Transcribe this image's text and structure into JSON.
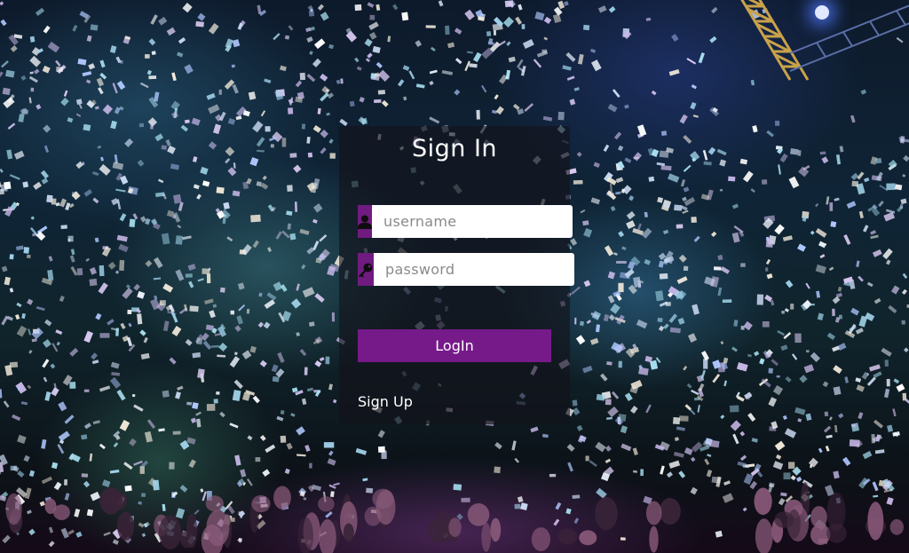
{
  "signin": {
    "title": "Sign In",
    "username": {
      "value": "",
      "placeholder": "username",
      "icon": "user-icon"
    },
    "password": {
      "value": "",
      "placeholder": "password",
      "icon": "key-icon"
    },
    "login_label": "LogIn",
    "signup_label": "Sign Up"
  },
  "colors": {
    "accent": "#761a8a",
    "icon_box": "#6f1b7f",
    "card_bg": "rgba(20,18,26,0.62)",
    "text": "#ffffff"
  },
  "background": {
    "icon": "concert-confetti-photo"
  }
}
